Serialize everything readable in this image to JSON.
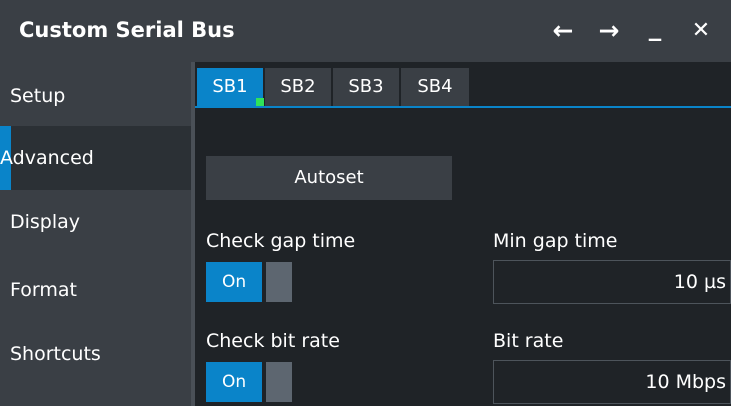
{
  "window": {
    "title": "Custom Serial Bus",
    "back_icon": "←",
    "forward_icon": "→",
    "minimize_icon": "_",
    "close_icon": "✕"
  },
  "sidebar": {
    "items": [
      {
        "label": "Setup"
      },
      {
        "label": "Advanced"
      },
      {
        "label": "Display"
      },
      {
        "label": "Format"
      },
      {
        "label": "Shortcuts"
      }
    ],
    "active": "Advanced"
  },
  "tabs": [
    {
      "label": "SB1"
    },
    {
      "label": "SB2"
    },
    {
      "label": "SB3"
    },
    {
      "label": "SB4"
    }
  ],
  "active_tab": "SB1",
  "main": {
    "autoset_label": "Autoset",
    "check_gap_time": {
      "label": "Check gap time",
      "state": "On"
    },
    "min_gap_time": {
      "label": "Min gap time",
      "value": "10 µs"
    },
    "check_bit_rate": {
      "label": "Check bit rate",
      "state": "On"
    },
    "bit_rate": {
      "label": "Bit rate",
      "value": "10 Mbps"
    }
  },
  "colors": {
    "accent": "#0a84c9",
    "panel": "#3a3f45",
    "background": "#1f2327",
    "indicator": "#2fe35a"
  }
}
